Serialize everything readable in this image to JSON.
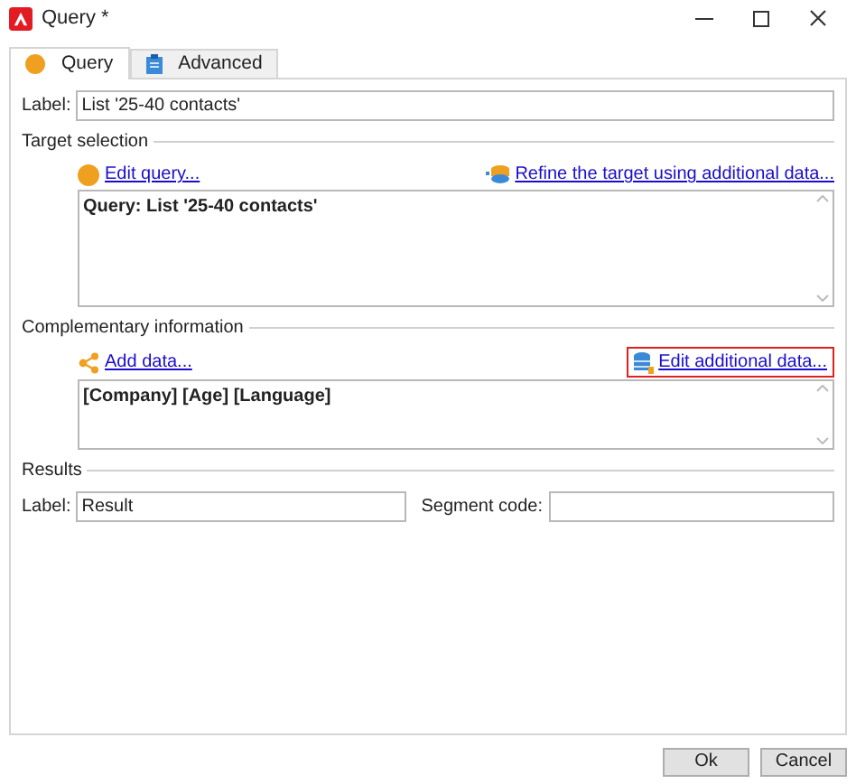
{
  "window": {
    "title": "Query *"
  },
  "tabs": [
    {
      "label": "Query",
      "kind": "query",
      "selected": true
    },
    {
      "label": "Advanced",
      "kind": "advanced",
      "selected": false
    }
  ],
  "label_field": {
    "label": "Label:",
    "value": "List '25-40 contacts'"
  },
  "target_selection": {
    "title": "Target selection",
    "edit_link": "Edit query...",
    "refine_link": "Refine the target using additional data...",
    "text": "Query: List '25-40 contacts'"
  },
  "complementary_information": {
    "title": "Complementary information",
    "add_link": "Add data...",
    "edit_link": "Edit additional data...",
    "edit_link_highlighted": true,
    "text": "[Company]  [Age]  [Language]"
  },
  "results": {
    "title": "Results",
    "label": "Label:",
    "value": "Result",
    "segment_label": "Segment code:"
  },
  "buttons": [
    "Ok",
    "Cancel"
  ]
}
